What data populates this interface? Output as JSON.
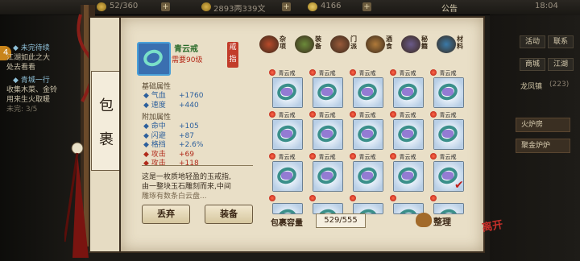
{
  "topbar": {
    "stamina": "52/360",
    "money": "2893两339文",
    "gold": "4166",
    "notice": "公告",
    "time": "18:04"
  },
  "quests": {
    "badge": "4",
    "lines": [
      {
        "text": "◆ 未完待续",
        "style": "title"
      },
      {
        "text": "江湖如此之大",
        "style": "normal"
      },
      {
        "text": "处去看看",
        "style": "normal"
      },
      {
        "text": "◆ 青城一行",
        "style": "title"
      },
      {
        "text": "收集木菜、金铃",
        "style": "normal"
      },
      {
        "text": "用来生火取暖",
        "style": "normal"
      },
      {
        "text": "未完: 3/5",
        "style": "fade"
      }
    ]
  },
  "right_menu": {
    "row1": [
      "活动",
      "联系"
    ],
    "row2": [
      "商城",
      "江湖"
    ],
    "row3_label": "龙凤镇",
    "row3_value": "(223)",
    "options": [
      "火炉房",
      "聚金炉炉"
    ]
  },
  "bag_label": [
    "包",
    "裹"
  ],
  "item": {
    "name": "青云戒",
    "requirement": "需要90级",
    "slot_badge": "戒指",
    "base_title": "基础属性",
    "base": [
      {
        "k": "◆ 气血",
        "v": "+1760",
        "color": "blue"
      },
      {
        "k": "◆ 速度",
        "v": "+440",
        "color": "blue"
      }
    ],
    "extra_title": "附加属性",
    "extra": [
      {
        "k": "◆ 命中",
        "v": "+105",
        "color": "blue"
      },
      {
        "k": "◆ 闪避",
        "v": "+87",
        "color": "blue"
      },
      {
        "k": "◆ 格挡",
        "v": "+2.6%",
        "color": "blue"
      },
      {
        "k": "◆ 攻击",
        "v": "+69",
        "color": "red"
      },
      {
        "k": "◆ 攻击",
        "v": "+118",
        "color": "red"
      }
    ],
    "description": [
      "这是一枚质地轻盈的玉戒指,",
      "由一整块玉石雕刻而来,中间",
      "雕琢有数条白云盘..."
    ]
  },
  "buttons": {
    "drop": "丢弃",
    "equip": "装备",
    "sort": "整理"
  },
  "tabs": [
    {
      "label": "杂项",
      "color": "#b84a2a"
    },
    {
      "label": "装备",
      "color": "#6b8a3a"
    },
    {
      "label": "门派",
      "color": "#9a5a3a"
    },
    {
      "label": "酒食",
      "color": "#b07a3a"
    },
    {
      "label": "秘籍",
      "color": "#6a5a8a"
    },
    {
      "label": "材料",
      "color": "#3a7aa8"
    }
  ],
  "grid": {
    "item_name": "青云戒",
    "rows": 4,
    "cols": 5,
    "checked_slot": 14
  },
  "capacity": {
    "label": "包裹容量",
    "value": "529/555"
  },
  "corner_logo": "离开"
}
